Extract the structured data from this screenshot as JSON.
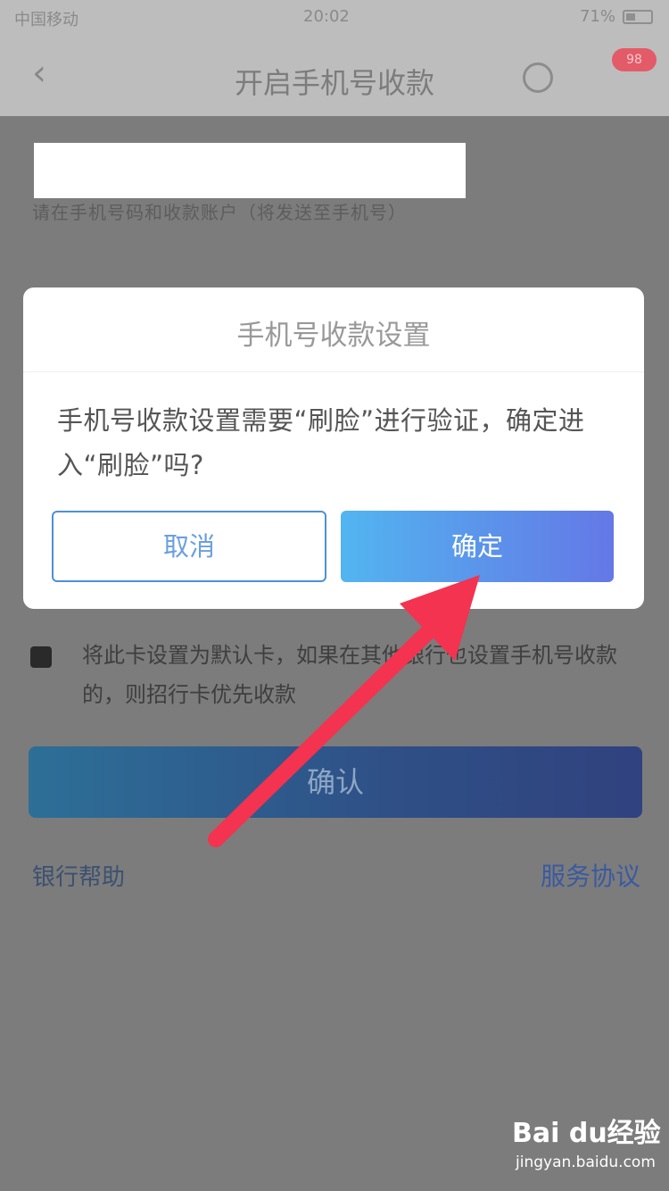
{
  "status_bar": {
    "carrier": "中国移动",
    "time": "20:02",
    "battery": "71%"
  },
  "nav": {
    "title": "开启手机号收款",
    "back_icon": "chevron-left-icon",
    "badge": "98"
  },
  "background": {
    "subtitle": "请在手机号码和收款账户（将发送至手机号）",
    "default_card_text": "将此卡设置为默认卡，如果在其他银行也设置手机号收款的，则招行卡优先收款",
    "confirm_label": "确认",
    "left_link": "银行帮助",
    "right_link": "服务协议"
  },
  "dialog": {
    "title": "手机号收款设置",
    "message": "手机号收款设置需要“刷脸”进行验证，确定进入“刷脸”吗?",
    "cancel_label": "取消",
    "ok_label": "确定"
  },
  "annotation": {
    "arrow_color": "#f3334f"
  },
  "watermark": {
    "brand": "Bai du经验",
    "site": "jingyan.baidu.com"
  }
}
